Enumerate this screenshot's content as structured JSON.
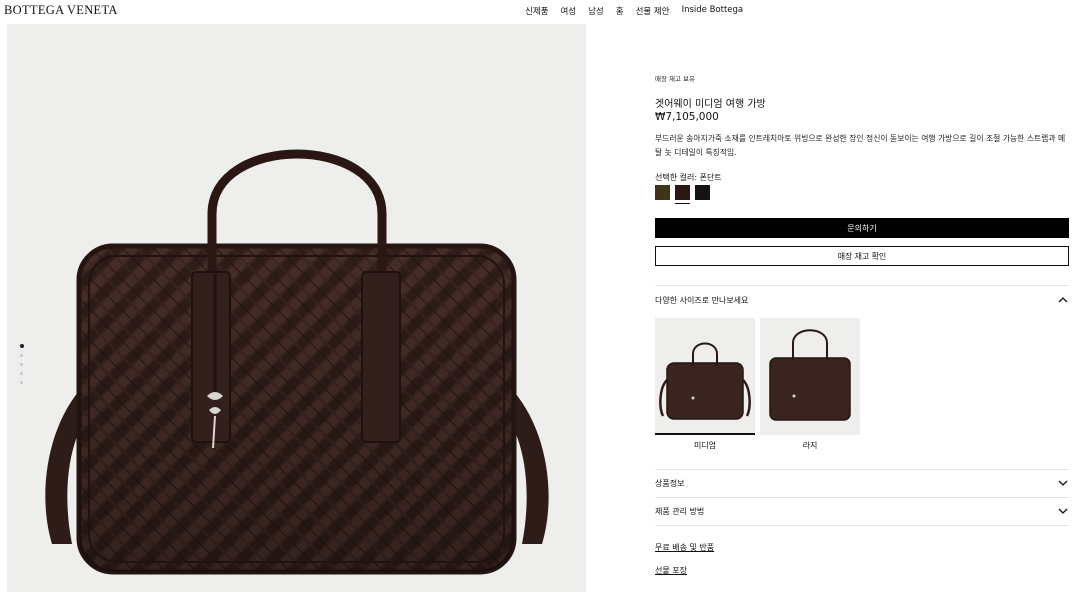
{
  "header": {
    "logo": "BOTTEGA VENETA",
    "nav": [
      "신제품",
      "여성",
      "남성",
      "홈",
      "선물 제안",
      "Inside Bottega"
    ]
  },
  "gallery": {
    "dot_count": 5,
    "active_index": 0
  },
  "product": {
    "stock_note": "매장 재고 보유",
    "title": "겟어웨이 미디엄 여행 가방",
    "price": "₩7,105,000",
    "description": "부드러운 송아지가죽 소재를 인트레치아토 위빙으로 완성한 장인 정신이 돋보이는 여행 가방으로 길이 조절 가능한 스트랩과 메탈 놋 디테일이 특징적임.",
    "color_label": "선택한 컬러: 폰단트",
    "swatches": [
      {
        "name": "swatch-olive",
        "color": "#3f3419",
        "selected": false
      },
      {
        "name": "swatch-fondant",
        "color": "#2a1714",
        "selected": true
      },
      {
        "name": "swatch-black",
        "color": "#141414",
        "selected": false
      }
    ]
  },
  "actions": {
    "inquire": "문의하기",
    "check_stock": "매장 재고 확인"
  },
  "sizes": {
    "heading": "다양한 사이즈로 만나보세요",
    "options": [
      {
        "label": "미디엄",
        "selected": true
      },
      {
        "label": "라지",
        "selected": false
      }
    ]
  },
  "accordions": {
    "product_info": "상품정보",
    "care": "제품 관리 방법"
  },
  "links": {
    "shipping": "무료 배송 및 반품",
    "gift_wrap": "선물 포장"
  },
  "colors": {
    "bag": "#3a2420",
    "bag_dark": "#241512",
    "image_bg": "#eeeeec",
    "hardware": "#d9d6cf"
  }
}
